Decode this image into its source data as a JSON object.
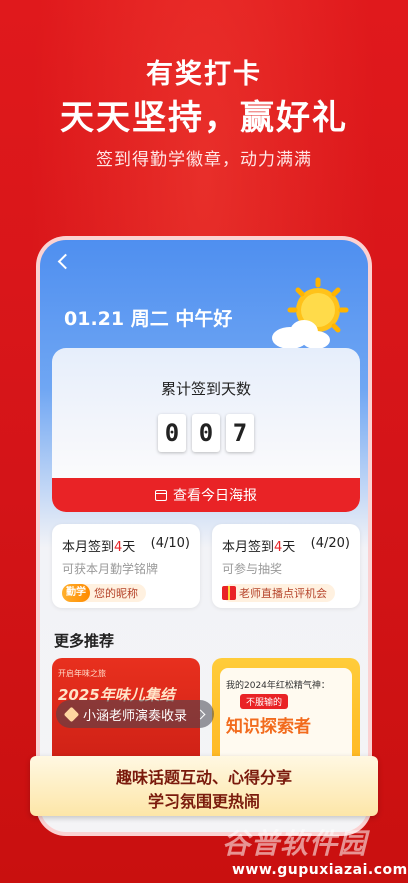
{
  "promo": {
    "line1": "有奖打卡",
    "line2": "天天坚持，赢好礼",
    "line3": "签到得勤学徽章，动力满满"
  },
  "app": {
    "back_icon": "chevron-left-icon",
    "greeting": "01.21 周二 中午好",
    "weather_icon": "sun-cloud-icon",
    "streak": {
      "label": "累计签到天数",
      "digits": [
        "0",
        "0",
        "7"
      ],
      "poster_button": "查看今日海报",
      "poster_icon": "calendar-icon"
    },
    "tasks": [
      {
        "title_prefix": "本月签到",
        "days": "4",
        "title_suffix": "天",
        "count": "(4/10)",
        "desc": "可获本月勤学铭牌",
        "badge_icon_text": "勤学",
        "badge_text": "您的昵称"
      },
      {
        "title_prefix": "本月签到",
        "days": "4",
        "title_suffix": "天",
        "count": "(4/20)",
        "desc": "可参与抽奖",
        "badge_icon": "gift-icon",
        "badge_text": "老师直播点评机会"
      }
    ],
    "more_title": "更多推荐",
    "recommendations": [
      {
        "tag": "开启年味之旅",
        "headline": "2025年味儿集结"
      },
      {
        "caption": "我的2024年红松精气神：",
        "tag": "不服输的",
        "headline": "知识探索者"
      }
    ],
    "toast": {
      "icon": "layers-icon",
      "text": "小涵老师演奏收录"
    }
  },
  "bottom_banner": {
    "line1": "趣味话题互动、心得分享",
    "line2": "学习氛围更热闹"
  },
  "watermark": {
    "logo": "谷普软件园",
    "url": "www.gupuxiazai.com"
  },
  "colors": {
    "brand_red": "#e92326",
    "sky_blue": "#4f8ff0",
    "banner_gold": "#fde6a8"
  }
}
